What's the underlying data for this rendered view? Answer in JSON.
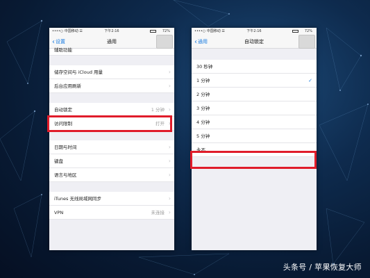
{
  "status_bar": {
    "carrier": "••••○ 中国移动 ☰",
    "left_time": "下午2:16",
    "right_time": "下午2:16",
    "battery": "72%"
  },
  "left_screen": {
    "back_label": "设置",
    "title": "通用",
    "partial_item": "辅助功能",
    "groups": [
      [
        {
          "label": "储存空间与 iCloud 用量",
          "value": ""
        },
        {
          "label": "后台应用刷新",
          "value": ""
        }
      ],
      [
        {
          "label": "自动锁定",
          "value": "1 分钟"
        },
        {
          "label": "访问限制",
          "value": "打开"
        }
      ],
      [
        {
          "label": "日期与时间",
          "value": ""
        },
        {
          "label": "键盘",
          "value": ""
        },
        {
          "label": "语言与地区",
          "value": ""
        }
      ],
      [
        {
          "label": "iTunes 无线局域网同步",
          "value": ""
        },
        {
          "label": "VPN",
          "value": "未连接"
        }
      ]
    ]
  },
  "right_screen": {
    "back_label": "通用",
    "title": "自动锁定",
    "options": [
      "30 秒钟",
      "1 分钟",
      "2 分钟",
      "3 分钟",
      "4 分钟",
      "5 分钟",
      "永不"
    ],
    "selected": "1 分钟"
  },
  "watermark": "头条号 / 苹果恢复大师",
  "colors": {
    "highlight_box": "#e01c2a",
    "ios_blue": "#1a7ce0",
    "background": "#0e2b4e"
  }
}
